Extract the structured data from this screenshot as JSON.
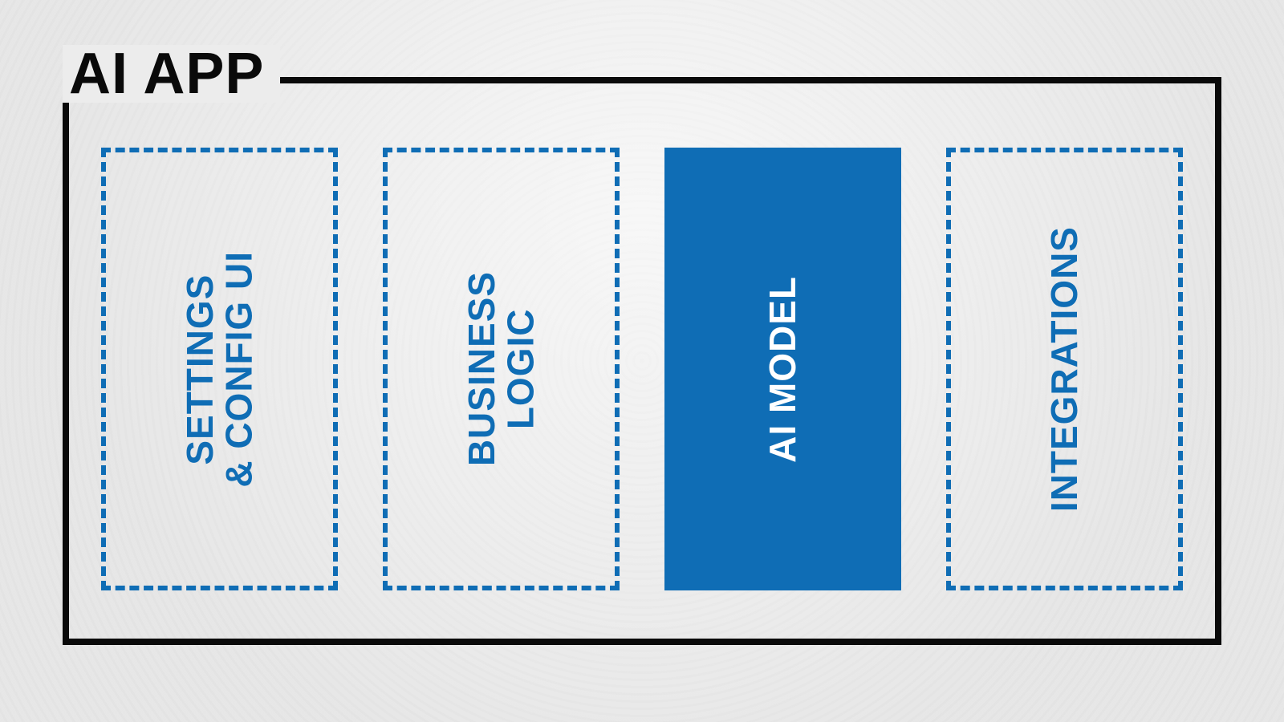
{
  "title": "AI APP",
  "colors": {
    "accent": "#0F6DB5",
    "ink": "#0a0a0a",
    "paper": "#ECECEC"
  },
  "cards": [
    {
      "label": "SETTINGS\n& CONFIG UI",
      "style": "dashed"
    },
    {
      "label": "BUSINESS\nLOGIC",
      "style": "dashed"
    },
    {
      "label": "AI MODEL",
      "style": "solid"
    },
    {
      "label": "INTEGRATIONS",
      "style": "dashed"
    }
  ]
}
